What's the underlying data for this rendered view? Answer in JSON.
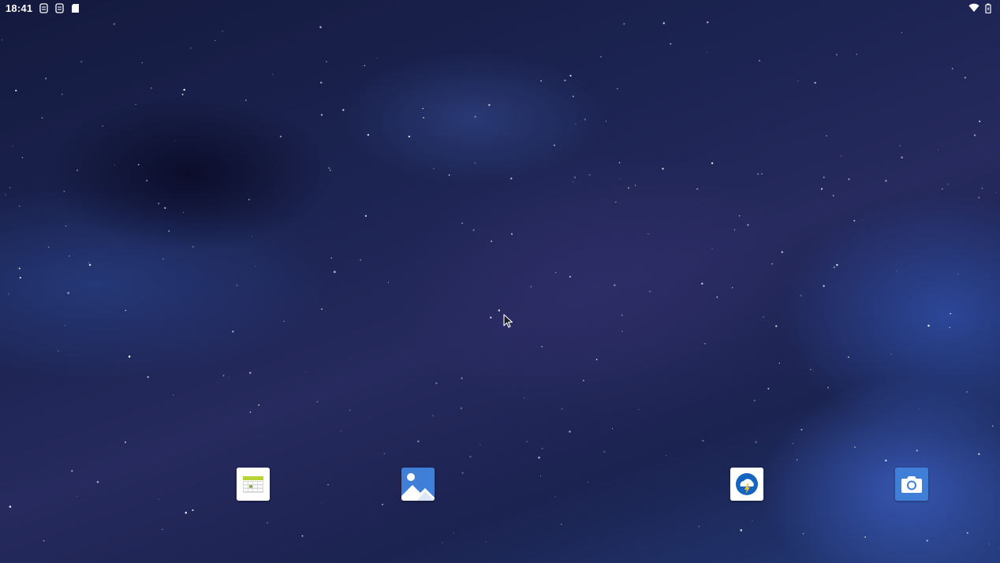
{
  "status_bar": {
    "time": "18:41",
    "left_icons": [
      "sim-card-icon",
      "sim-card-icon",
      "sd-card-icon"
    ],
    "right_icons": [
      "wifi-icon",
      "battery-icon"
    ]
  },
  "dock": {
    "apps": [
      {
        "icon": "calendar-app-icon",
        "colors": {
          "bg": "#ffffff",
          "accent": "#b5d334"
        }
      },
      {
        "icon": "gallery-app-icon",
        "colors": {
          "bg": "#3f7fd8",
          "accent": "#ffffff"
        }
      },
      {
        "icon": "weather-app-icon",
        "colors": {
          "bg": "#ffffff",
          "accent": "#1565c0"
        }
      },
      {
        "icon": "camera-app-icon",
        "colors": {
          "bg": "#3f7fd8",
          "accent": "#ffffff"
        }
      }
    ]
  },
  "wallpaper": {
    "theme": "dark blue fluid starfield",
    "colors": {
      "base": "#1c2452",
      "highlight": "#3e62c8"
    }
  },
  "pointer": {
    "icon": "mouse-pointer-icon"
  }
}
